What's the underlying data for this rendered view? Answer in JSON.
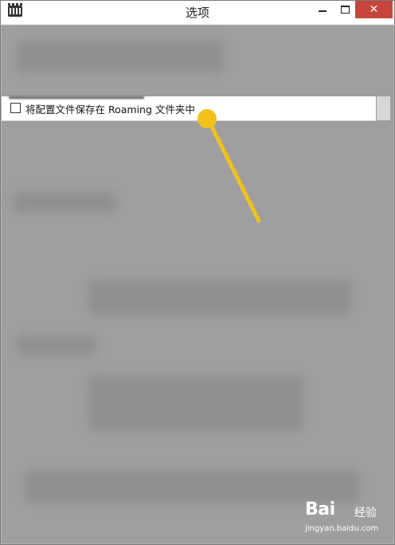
{
  "window": {
    "title": "选项",
    "close_glyph": "✕"
  },
  "option": {
    "label": "将配置文件保存在 Roaming 文件夹中",
    "checked": false
  },
  "colors": {
    "close_button": "#c7463b",
    "pointer": "#f2c21b",
    "overlay": "#9f9f9f"
  },
  "watermark": {
    "logo": "Bai",
    "logo_suffix": "经验",
    "url": "jingyan.baidu.com"
  }
}
